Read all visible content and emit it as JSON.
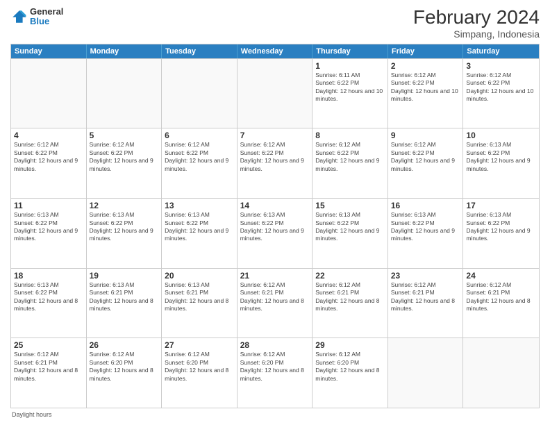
{
  "logo": {
    "line1": "General",
    "line2": "Blue"
  },
  "title": "February 2024",
  "subtitle": "Simpang, Indonesia",
  "days_header": [
    "Sunday",
    "Monday",
    "Tuesday",
    "Wednesday",
    "Thursday",
    "Friday",
    "Saturday"
  ],
  "weeks": [
    [
      {
        "day": "",
        "info": ""
      },
      {
        "day": "",
        "info": ""
      },
      {
        "day": "",
        "info": ""
      },
      {
        "day": "",
        "info": ""
      },
      {
        "day": "1",
        "info": "Sunrise: 6:11 AM\nSunset: 6:22 PM\nDaylight: 12 hours and 10 minutes."
      },
      {
        "day": "2",
        "info": "Sunrise: 6:12 AM\nSunset: 6:22 PM\nDaylight: 12 hours and 10 minutes."
      },
      {
        "day": "3",
        "info": "Sunrise: 6:12 AM\nSunset: 6:22 PM\nDaylight: 12 hours and 10 minutes."
      }
    ],
    [
      {
        "day": "4",
        "info": "Sunrise: 6:12 AM\nSunset: 6:22 PM\nDaylight: 12 hours and 9 minutes."
      },
      {
        "day": "5",
        "info": "Sunrise: 6:12 AM\nSunset: 6:22 PM\nDaylight: 12 hours and 9 minutes."
      },
      {
        "day": "6",
        "info": "Sunrise: 6:12 AM\nSunset: 6:22 PM\nDaylight: 12 hours and 9 minutes."
      },
      {
        "day": "7",
        "info": "Sunrise: 6:12 AM\nSunset: 6:22 PM\nDaylight: 12 hours and 9 minutes."
      },
      {
        "day": "8",
        "info": "Sunrise: 6:12 AM\nSunset: 6:22 PM\nDaylight: 12 hours and 9 minutes."
      },
      {
        "day": "9",
        "info": "Sunrise: 6:12 AM\nSunset: 6:22 PM\nDaylight: 12 hours and 9 minutes."
      },
      {
        "day": "10",
        "info": "Sunrise: 6:13 AM\nSunset: 6:22 PM\nDaylight: 12 hours and 9 minutes."
      }
    ],
    [
      {
        "day": "11",
        "info": "Sunrise: 6:13 AM\nSunset: 6:22 PM\nDaylight: 12 hours and 9 minutes."
      },
      {
        "day": "12",
        "info": "Sunrise: 6:13 AM\nSunset: 6:22 PM\nDaylight: 12 hours and 9 minutes."
      },
      {
        "day": "13",
        "info": "Sunrise: 6:13 AM\nSunset: 6:22 PM\nDaylight: 12 hours and 9 minutes."
      },
      {
        "day": "14",
        "info": "Sunrise: 6:13 AM\nSunset: 6:22 PM\nDaylight: 12 hours and 9 minutes."
      },
      {
        "day": "15",
        "info": "Sunrise: 6:13 AM\nSunset: 6:22 PM\nDaylight: 12 hours and 9 minutes."
      },
      {
        "day": "16",
        "info": "Sunrise: 6:13 AM\nSunset: 6:22 PM\nDaylight: 12 hours and 9 minutes."
      },
      {
        "day": "17",
        "info": "Sunrise: 6:13 AM\nSunset: 6:22 PM\nDaylight: 12 hours and 9 minutes."
      }
    ],
    [
      {
        "day": "18",
        "info": "Sunrise: 6:13 AM\nSunset: 6:22 PM\nDaylight: 12 hours and 8 minutes."
      },
      {
        "day": "19",
        "info": "Sunrise: 6:13 AM\nSunset: 6:21 PM\nDaylight: 12 hours and 8 minutes."
      },
      {
        "day": "20",
        "info": "Sunrise: 6:13 AM\nSunset: 6:21 PM\nDaylight: 12 hours and 8 minutes."
      },
      {
        "day": "21",
        "info": "Sunrise: 6:12 AM\nSunset: 6:21 PM\nDaylight: 12 hours and 8 minutes."
      },
      {
        "day": "22",
        "info": "Sunrise: 6:12 AM\nSunset: 6:21 PM\nDaylight: 12 hours and 8 minutes."
      },
      {
        "day": "23",
        "info": "Sunrise: 6:12 AM\nSunset: 6:21 PM\nDaylight: 12 hours and 8 minutes."
      },
      {
        "day": "24",
        "info": "Sunrise: 6:12 AM\nSunset: 6:21 PM\nDaylight: 12 hours and 8 minutes."
      }
    ],
    [
      {
        "day": "25",
        "info": "Sunrise: 6:12 AM\nSunset: 6:21 PM\nDaylight: 12 hours and 8 minutes."
      },
      {
        "day": "26",
        "info": "Sunrise: 6:12 AM\nSunset: 6:20 PM\nDaylight: 12 hours and 8 minutes."
      },
      {
        "day": "27",
        "info": "Sunrise: 6:12 AM\nSunset: 6:20 PM\nDaylight: 12 hours and 8 minutes."
      },
      {
        "day": "28",
        "info": "Sunrise: 6:12 AM\nSunset: 6:20 PM\nDaylight: 12 hours and 8 minutes."
      },
      {
        "day": "29",
        "info": "Sunrise: 6:12 AM\nSunset: 6:20 PM\nDaylight: 12 hours and 8 minutes."
      },
      {
        "day": "",
        "info": ""
      },
      {
        "day": "",
        "info": ""
      }
    ]
  ],
  "footer": "Daylight hours"
}
